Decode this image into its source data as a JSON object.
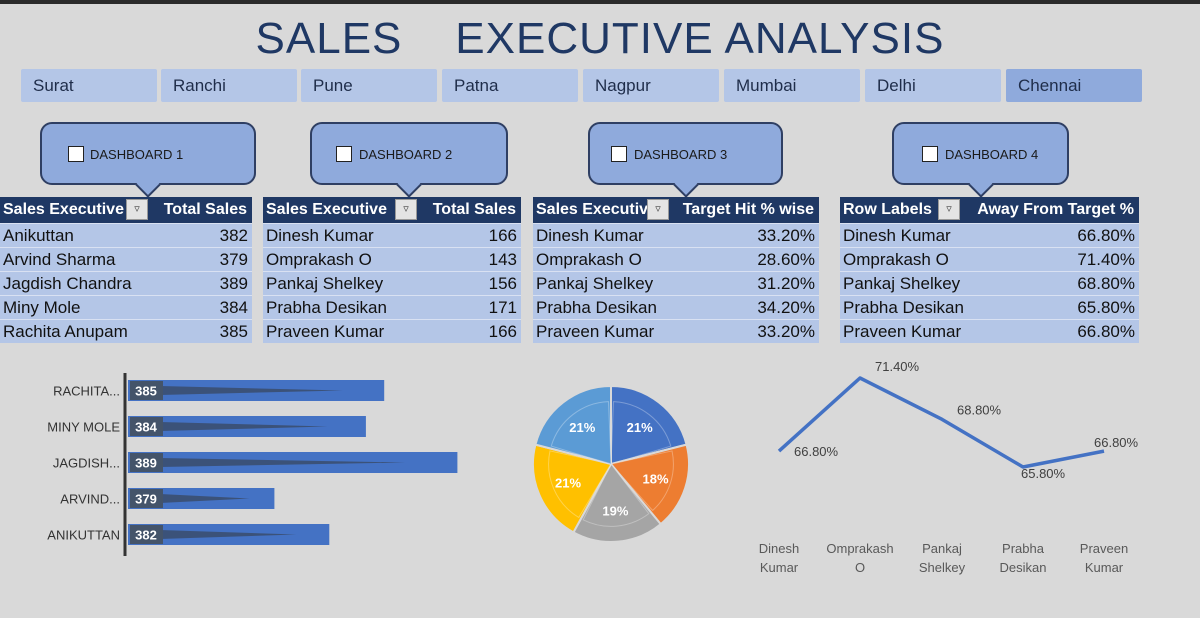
{
  "title": "SALES    EXECUTIVE ANALYSIS",
  "cities": [
    "Surat",
    "Ranchi",
    "Pune",
    "Patna",
    "Nagpur",
    "Mumbai",
    "Delhi",
    "Chennai"
  ],
  "selected_city": "Chennai",
  "dashboards": [
    "DASHBOARD 1",
    "DASHBOARD 2",
    "DASHBOARD 3",
    "DASHBOARD 4"
  ],
  "tables": [
    {
      "headers": [
        "Sales Executive",
        "Total Sales"
      ],
      "rows": [
        [
          "Anikuttan",
          "382"
        ],
        [
          "Arvind Sharma",
          "379"
        ],
        [
          "Jagdish Chandra",
          "389"
        ],
        [
          "Miny Mole",
          "384"
        ],
        [
          "Rachita Anupam",
          "385"
        ]
      ]
    },
    {
      "headers": [
        "Sales Executive",
        "Total Sales"
      ],
      "rows": [
        [
          "Dinesh Kumar",
          "166"
        ],
        [
          "Omprakash O",
          "143"
        ],
        [
          "Pankaj Shelkey",
          "156"
        ],
        [
          "Prabha Desikan",
          "171"
        ],
        [
          "Praveen Kumar",
          "166"
        ]
      ]
    },
    {
      "headers": [
        "Sales Executive",
        "Target Hit % wise"
      ],
      "rows": [
        [
          "Dinesh Kumar",
          "33.20%"
        ],
        [
          "Omprakash O",
          "28.60%"
        ],
        [
          "Pankaj Shelkey",
          "31.20%"
        ],
        [
          "Prabha Desikan",
          "34.20%"
        ],
        [
          "Praveen Kumar",
          "33.20%"
        ]
      ]
    },
    {
      "headers": [
        "Row Labels",
        "Away From Target %"
      ],
      "rows": [
        [
          "Dinesh Kumar",
          "66.80%"
        ],
        [
          "Omprakash O",
          "71.40%"
        ],
        [
          "Pankaj Shelkey",
          "68.80%"
        ],
        [
          "Prabha Desikan",
          "65.80%"
        ],
        [
          "Praveen Kumar",
          "66.80%"
        ]
      ]
    }
  ],
  "colors": {
    "bar": "#4472c4",
    "label_box": "#44546a",
    "line": "#4472c4"
  },
  "chart_data": [
    {
      "type": "bar",
      "orientation": "horizontal",
      "categories": [
        "RACHITA...",
        "MINY MOLE",
        "JAGDISH...",
        "ARVIND...",
        "ANIKUTTAN"
      ],
      "values": [
        385,
        384,
        389,
        379,
        382
      ],
      "data_labels": [
        "385",
        "384",
        "389",
        "379",
        "382"
      ]
    },
    {
      "type": "pie",
      "values": [
        21,
        18,
        19,
        21,
        21
      ],
      "labels": [
        "21%",
        "18%",
        "19%",
        "21%",
        "21%"
      ],
      "colors": [
        "#4472c4",
        "#ed7d31",
        "#a5a5a5",
        "#ffc000",
        "#5b9bd5"
      ]
    },
    {
      "type": "line",
      "categories": [
        "Dinesh Kumar",
        "Omprakash O",
        "Pankaj Shelkey",
        "Prabha Desikan",
        "Praveen Kumar"
      ],
      "values": [
        66.8,
        71.4,
        68.8,
        65.8,
        66.8
      ],
      "data_labels": [
        "66.80%",
        "71.40%",
        "68.80%",
        "65.80%",
        "66.80%"
      ]
    }
  ]
}
